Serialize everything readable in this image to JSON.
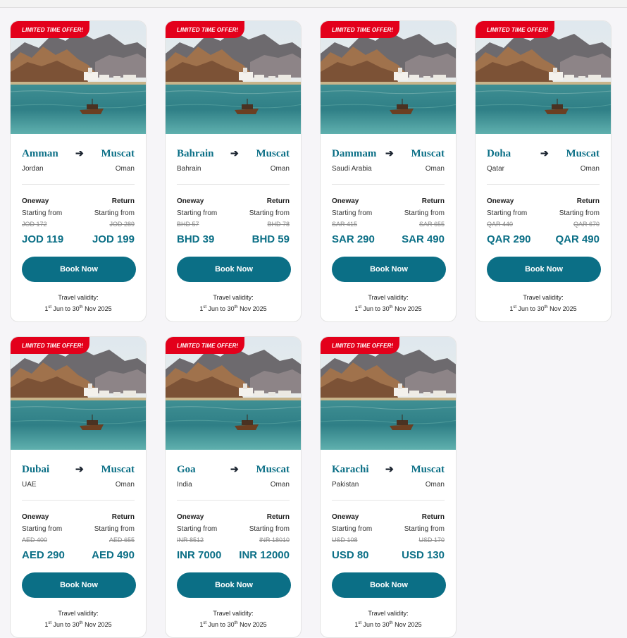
{
  "badge": "LIMITED TIME OFFER!",
  "labels": {
    "oneway": "Oneway",
    "return": "Return",
    "starting_from": "Starting from",
    "book_now": "Book Now",
    "travel_validity": "Travel validity:",
    "validity_from_day": "1",
    "validity_from_sup": "st",
    "validity_mid": " Jun to 30",
    "validity_to_sup": "th",
    "validity_end": " Nov 2025"
  },
  "colors": {
    "accent": "#0b6f86",
    "badge": "#e3001b"
  },
  "icons": {
    "arrow": "right-arrow-icon"
  },
  "cards": [
    {
      "from": "Amman",
      "from_country": "Jordan",
      "to": "Muscat",
      "to_country": "Oman",
      "old_oneway": "JOD 172",
      "old_return": "JOD 289",
      "oneway_price": "JOD 119",
      "return_price": "JOD 199"
    },
    {
      "from": "Bahrain",
      "from_country": "Bahrain",
      "to": "Muscat",
      "to_country": "Oman",
      "old_oneway": "BHD 57",
      "old_return": "BHD 78",
      "oneway_price": "BHD 39",
      "return_price": "BHD 59"
    },
    {
      "from": "Dammam",
      "from_country": "Saudi Arabia",
      "to": "Muscat",
      "to_country": "Oman",
      "old_oneway": "SAR 415",
      "old_return": "SAR 655",
      "oneway_price": "SAR 290",
      "return_price": "SAR 490"
    },
    {
      "from": "Doha",
      "from_country": "Qatar",
      "to": "Muscat",
      "to_country": "Oman",
      "old_oneway": "QAR 440",
      "old_return": "QAR 670",
      "oneway_price": "QAR 290",
      "return_price": "QAR 490"
    },
    {
      "from": "Dubai",
      "from_country": "UAE",
      "to": "Muscat",
      "to_country": "Oman",
      "old_oneway": "AED 400",
      "old_return": "AED 655",
      "oneway_price": "AED 290",
      "return_price": "AED 490"
    },
    {
      "from": "Goa",
      "from_country": "India",
      "to": "Muscat",
      "to_country": "Oman",
      "old_oneway": "INR 8512",
      "old_return": "INR 18010",
      "oneway_price": "INR 7000",
      "return_price": "INR 12000"
    },
    {
      "from": "Karachi",
      "from_country": "Pakistan",
      "to": "Muscat",
      "to_country": "Oman",
      "old_oneway": "USD 108",
      "old_return": "USD 170",
      "oneway_price": "USD 80",
      "return_price": "USD 130"
    }
  ]
}
